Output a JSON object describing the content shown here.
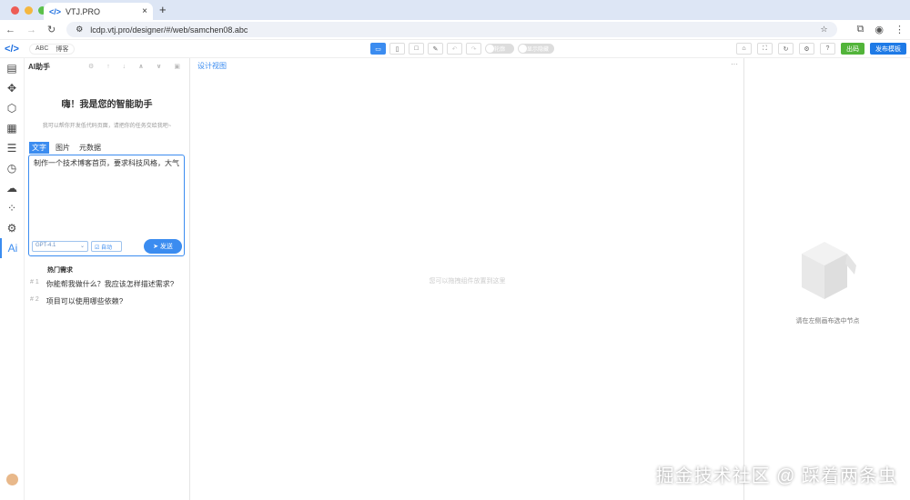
{
  "browser": {
    "tab_title": "VTJ.PRO",
    "url": "lcdp.vtj.pro/designer/#/web/samchen08.abc"
  },
  "toolbar": {
    "project": "ABC",
    "project_name": "博客",
    "toggle1": "轮廓",
    "toggle2": "显示隐藏",
    "preview": "出码",
    "publish": "发布模板"
  },
  "panel": {
    "title": "AI助手",
    "greeting": "嗨！我是您的智能助手",
    "subtitle": "我可以帮你开发低代码页面，请把你的任务交给我吧~",
    "tabs": [
      "文字",
      "图片",
      "元数据"
    ],
    "prompt": "制作一个技术博客首页，要求科技风格，大气",
    "model": "GPT-4.1",
    "auto": "自动",
    "send": "发送",
    "hot_title": "热门需求",
    "questions": [
      {
        "n": "# 1",
        "text": "你能帮我做什么？我应该怎样描述需求?"
      },
      {
        "n": "# 2",
        "text": "项目可以使用哪些依赖?"
      }
    ]
  },
  "design": {
    "tab": "设计视图",
    "drop_hint": "您可以拖拽组件放置到这里"
  },
  "right": {
    "empty": "请在左侧画布选中节点"
  },
  "watermark": "掘金技术社区 @ 踩着两条虫",
  "colors": {
    "accent": "#3b8cf0",
    "publish": "#1e7ae6",
    "preview": "#52b43a"
  }
}
